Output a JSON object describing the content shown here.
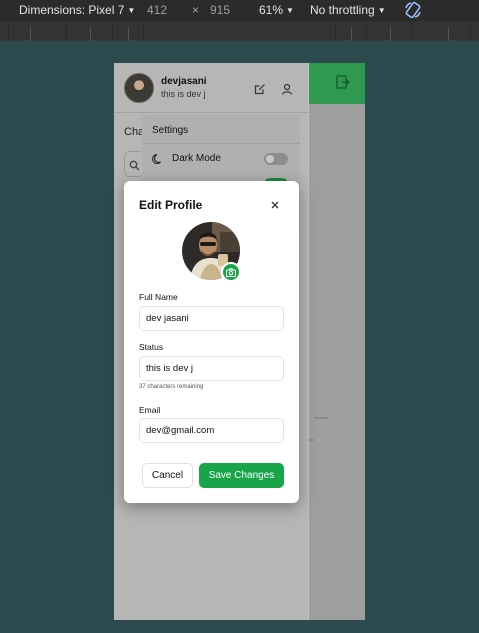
{
  "devtools": {
    "dimensions_label": "Dimensions: Pixel 7",
    "width": "412",
    "times": "×",
    "height": "915",
    "zoom": "61%",
    "throttling": "No throttling",
    "icons": [
      "chevron-down-icon",
      "rotate-icon"
    ]
  },
  "sidebar": {
    "username": "devjasani",
    "status": "this is dev j",
    "chats_title": "Cha",
    "icons": [
      "avatar",
      "edit-icon",
      "user-icon",
      "search-icon"
    ]
  },
  "settings_menu": {
    "title": "Settings",
    "dark_mode_label": "Dark Mode",
    "dark_mode_on": false,
    "notifications_on": true,
    "icons": [
      "moon-icon"
    ]
  },
  "modal": {
    "title": "Edit Profile",
    "full_name_label": "Full Name",
    "full_name_value": "dev jasani",
    "status_label": "Status",
    "status_value": "this is dev j",
    "status_hint": "37 characters remaining",
    "email_label": "Email",
    "email_value": "dev@gmail.com",
    "cancel_label": "Cancel",
    "save_label": "Save Changes",
    "icons": [
      "close-icon",
      "camera-icon"
    ]
  },
  "colors": {
    "accent": "#18a54a",
    "page_background": "#2d4a4f",
    "devtools_bar": "#2b2b2b"
  }
}
